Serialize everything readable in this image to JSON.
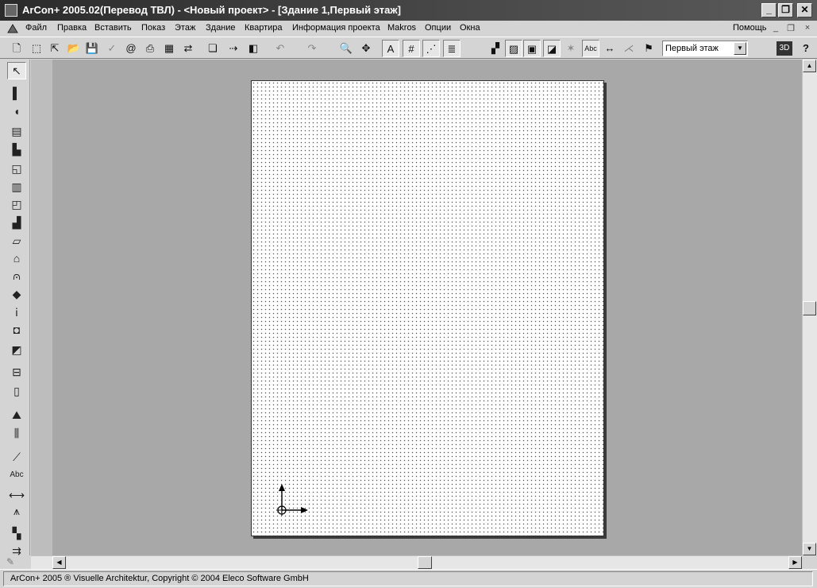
{
  "window": {
    "title": "ArCon+  2005.02(Перевод ТВЛ)  - <Новый проект> - [Здание 1,Первый этаж]",
    "icon": "arcon-app-icon",
    "minimize_glyph": "_",
    "restore_glyph": "❐",
    "close_glyph": "✕"
  },
  "menubar": {
    "items": [
      {
        "label": "Файл",
        "accel": "Ф",
        "rest": "айл"
      },
      {
        "label": "Правка",
        "accel": "П",
        "rest": "равка"
      },
      {
        "label": "Вставить",
        "accel": "В",
        "rest": "ставить"
      },
      {
        "label": "Показ",
        "accel": "П",
        "rest": "оказ"
      },
      {
        "label": "Этаж",
        "accel": "Э",
        "rest": "таж"
      },
      {
        "label": "Здание",
        "accel": "З",
        "rest": "дание"
      },
      {
        "label": "Квартира",
        "accel": "К",
        "rest": "вартира"
      },
      {
        "label": "Информация проекта",
        "accel": "И",
        "rest": "нформация проекта"
      },
      {
        "label": "Makros",
        "accel": "M",
        "rest": "akros"
      },
      {
        "label": "Опции",
        "accel": "О",
        "rest": "пции"
      },
      {
        "label": "Окна",
        "accel": "",
        "rest": "Окна"
      }
    ],
    "help_label": "Помощь",
    "mdi_minimize": "_",
    "mdi_restore": "❐",
    "mdi_close": "×"
  },
  "toolbar": {
    "icons": [
      {
        "name": "new-icon",
        "glyph": "🗋"
      },
      {
        "name": "select-window-icon",
        "glyph": "⬚"
      },
      {
        "name": "select-cursor-icon",
        "glyph": "⇱"
      },
      {
        "name": "open-icon",
        "glyph": "📂"
      },
      {
        "name": "save-icon",
        "glyph": "💾"
      },
      {
        "name": "check-icon",
        "glyph": "✓"
      },
      {
        "name": "email-icon",
        "glyph": "@"
      },
      {
        "name": "print-icon",
        "glyph": "⎙"
      },
      {
        "name": "print-preview-icon",
        "glyph": "▦"
      },
      {
        "name": "export-icon",
        "glyph": "⇄"
      },
      {
        "name": "copy-object-icon",
        "glyph": "❏"
      },
      {
        "name": "move-icon",
        "glyph": "⇢"
      },
      {
        "name": "3d-box-icon",
        "glyph": "◧"
      },
      {
        "name": "undo-icon",
        "glyph": "↶"
      },
      {
        "name": "redo-icon",
        "glyph": "↷"
      },
      {
        "name": "zoom-icon",
        "glyph": "🔍"
      },
      {
        "name": "navigate-icon",
        "glyph": "✥"
      },
      {
        "name": "text-icon",
        "glyph": "A"
      },
      {
        "name": "grid-icon",
        "glyph": "#"
      },
      {
        "name": "snap-icon",
        "glyph": "⋰"
      },
      {
        "name": "hpgl-dxf-icon",
        "glyph": "≣"
      },
      {
        "name": "walls-icon",
        "glyph": "▞"
      },
      {
        "name": "hatch-icon",
        "glyph": "▨"
      },
      {
        "name": "rooms-icon",
        "glyph": "▣"
      },
      {
        "name": "stairs-icon",
        "glyph": "◪"
      },
      {
        "name": "roof-icon",
        "glyph": "✶"
      },
      {
        "name": "label-abc-icon",
        "glyph": "Abc"
      },
      {
        "name": "dimension-icon",
        "glyph": "↔"
      },
      {
        "name": "axis-icon",
        "glyph": "⋌"
      },
      {
        "name": "marker-icon",
        "glyph": "⚑"
      }
    ],
    "floor_select": {
      "value": "Первый этаж"
    },
    "view3d_label": "3D",
    "help_cursor_glyph": "?"
  },
  "left_toolbar": {
    "icons": [
      {
        "name": "pointer-icon",
        "glyph": "↖"
      },
      {
        "name": "wall-icon",
        "glyph": "▌"
      },
      {
        "name": "arc-wall-icon",
        "glyph": "◖"
      },
      {
        "name": "window-icon",
        "glyph": "▤"
      },
      {
        "name": "door-icon",
        "glyph": "▙"
      },
      {
        "name": "opening-icon",
        "glyph": "◱"
      },
      {
        "name": "stair-icon",
        "glyph": "▥"
      },
      {
        "name": "room-icon",
        "glyph": "◰"
      },
      {
        "name": "step-icon",
        "glyph": "▟"
      },
      {
        "name": "slab-icon",
        "glyph": "▱"
      },
      {
        "name": "roof-icon",
        "glyph": "⌂"
      },
      {
        "name": "dormer-icon",
        "glyph": "⩀"
      },
      {
        "name": "furniture-icon",
        "glyph": "◆"
      },
      {
        "name": "light-icon",
        "glyph": "ⅰ"
      },
      {
        "name": "column-icon",
        "glyph": "◘"
      },
      {
        "name": "corner-icon",
        "glyph": "◩"
      },
      {
        "name": "cabinet-icon",
        "glyph": "⊟"
      },
      {
        "name": "niche-icon",
        "glyph": "▯"
      },
      {
        "name": "terrain-icon",
        "glyph": "⛰"
      },
      {
        "name": "fence-icon",
        "glyph": "⫼"
      },
      {
        "name": "line-icon",
        "glyph": "⟋"
      },
      {
        "name": "text-abc-icon",
        "glyph": "Abc"
      },
      {
        "name": "measure-icon",
        "glyph": "⟷"
      },
      {
        "name": "section-icon",
        "glyph": "⩚"
      },
      {
        "name": "stair-dimension-icon",
        "glyph": "▚"
      },
      {
        "name": "move-arrows-icon",
        "glyph": "⇉"
      }
    ]
  },
  "statusbar": {
    "text": "ArCon+ 2005 ® Visuelle Architektur, Copyright © 2004 Eleco Software GmbH"
  },
  "colors": {
    "face": "#d4d4d4",
    "workspace": "#a8a8a8",
    "sheet": "#ffffff",
    "title_dark": "#2b2b2b"
  }
}
